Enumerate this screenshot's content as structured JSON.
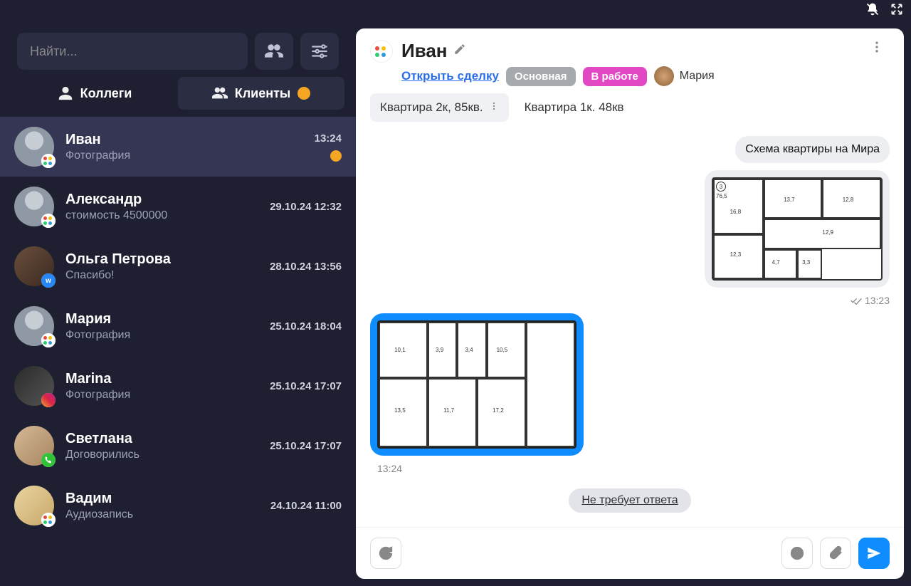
{
  "search": {
    "placeholder": "Найти..."
  },
  "tabs": {
    "colleagues": "Коллеги",
    "clients": "Клиенты"
  },
  "contacts": [
    {
      "name": "Иван",
      "preview": "Фотография",
      "time": "13:24",
      "unread": true,
      "selected": true,
      "avatar": "default",
      "sub": "multi"
    },
    {
      "name": "Александр",
      "preview": "стоимость 4500000",
      "time": "29.10.24 12:32",
      "unread": false,
      "avatar": "default",
      "sub": "multi"
    },
    {
      "name": "Ольга Петрова",
      "preview": "Спасибо!",
      "time": "28.10.24 13:56",
      "unread": false,
      "avatar": "photo1",
      "sub": "vk"
    },
    {
      "name": "Мария",
      "preview": "Фотография",
      "time": "25.10.24 18:04",
      "unread": false,
      "avatar": "default",
      "sub": "multi"
    },
    {
      "name": "Marina",
      "preview": "Фотография",
      "time": "25.10.24 17:07",
      "unread": false,
      "avatar": "photo2",
      "sub": "ig"
    },
    {
      "name": "Светлана",
      "preview": "Договорились",
      "time": "25.10.24 17:07",
      "unread": false,
      "avatar": "photo3",
      "sub": "phone"
    },
    {
      "name": "Вадим",
      "preview": "Аудиозапись",
      "time": "24.10.24 11:00",
      "unread": false,
      "avatar": "photo4",
      "sub": "multi"
    }
  ],
  "chat": {
    "title": "Иван",
    "open_deal": "Открыть сделку",
    "pill_main": "Основная",
    "pill_status": "В работе",
    "assignee": "Мария",
    "deal_tabs": [
      "Квартира 2к, 85кв.",
      "Квартира 1к. 48кв"
    ],
    "messages": {
      "m1_text": "Схема квартиры на Мира",
      "m2_time": "13:23",
      "m3_time": "13:24",
      "status": "Не требует ответа"
    },
    "floorplan_in": {
      "apt_no": "3",
      "area": "76,5",
      "rooms": [
        "16,8",
        "13,7",
        "12,8",
        "12,3",
        "4,7",
        "3,3",
        "12,9"
      ]
    },
    "floorplan_out": {
      "rooms": [
        "10,1",
        "3,9",
        "3,4",
        "10,5",
        "13,5",
        "11,7",
        "17,2"
      ]
    }
  }
}
